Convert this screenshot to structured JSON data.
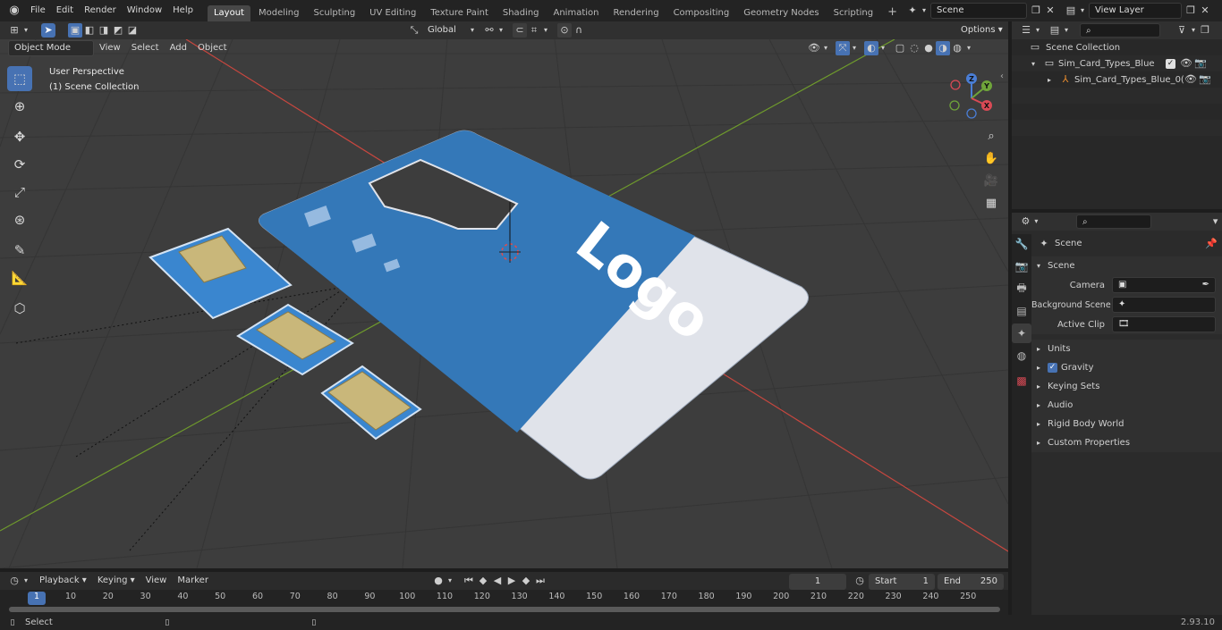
{
  "menu": {
    "file": "File",
    "edit": "Edit",
    "render": "Render",
    "window": "Window",
    "help": "Help"
  },
  "workspaces": [
    "Layout",
    "Modeling",
    "Sculpting",
    "UV Editing",
    "Texture Paint",
    "Shading",
    "Animation",
    "Rendering",
    "Compositing",
    "Geometry Nodes",
    "Scripting"
  ],
  "scene_field": "Scene",
  "view_layer_field": "View Layer",
  "header": {
    "orientation": "Global",
    "options": "Options",
    "mode": "Object Mode",
    "view": "View",
    "select": "Select",
    "add": "Add",
    "object": "Object"
  },
  "viewport": {
    "perspective": "User Perspective",
    "collection": "(1) Scene Collection",
    "card_logo": "Logo",
    "gizmo": {
      "z": "Z",
      "y": "Y",
      "x": "X"
    }
  },
  "outliner": {
    "scene_collection": "Scene Collection",
    "collection_name": "Sim_Card_Types_Blue",
    "object_name": "Sim_Card_Types_Blue_0("
  },
  "properties": {
    "scene_title": "Scene",
    "panel_scene": "Scene",
    "camera_label": "Camera",
    "background_label": "Background Scene",
    "active_clip_label": "Active Clip",
    "panels": [
      "Units",
      "Gravity",
      "Keying Sets",
      "Audio",
      "Rigid Body World",
      "Custom Properties"
    ]
  },
  "timeline": {
    "playback": "Playback",
    "keying": "Keying",
    "view": "View",
    "marker": "Marker",
    "current_frame": "1",
    "start_label": "Start",
    "start_value": "1",
    "end_label": "End",
    "end_value": "250",
    "ticks": [
      "1",
      "10",
      "20",
      "30",
      "40",
      "50",
      "60",
      "70",
      "80",
      "90",
      "100",
      "110",
      "120",
      "130",
      "140",
      "150",
      "160",
      "170",
      "180",
      "190",
      "200",
      "210",
      "220",
      "230",
      "240",
      "250"
    ]
  },
  "status": {
    "select": "Select",
    "version": "2.93.10"
  },
  "colors": {
    "accent": "#4772b3",
    "card_blue": "#3478b8",
    "card_white": "#e0e3ea",
    "chip_gold": "#c9b77a",
    "axis_x": "#c8473f",
    "axis_y": "#6f9b2c"
  }
}
